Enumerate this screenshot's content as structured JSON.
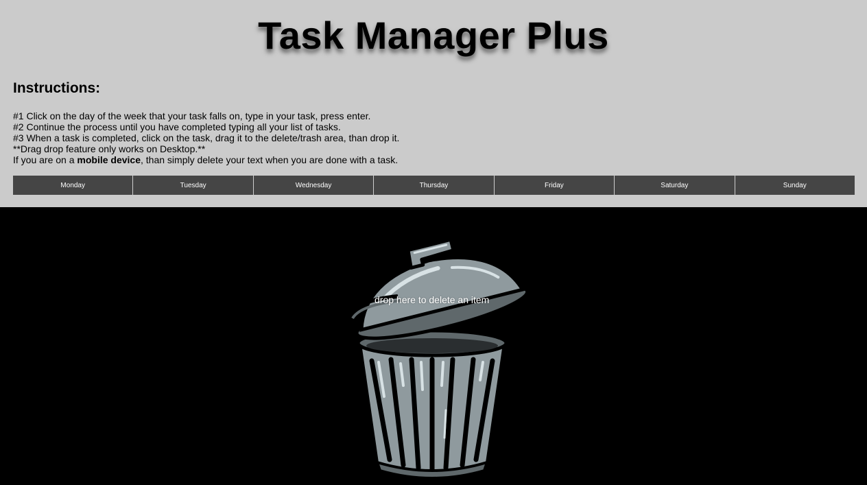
{
  "header": {
    "title": "Task Manager Plus"
  },
  "instructions": {
    "heading": "Instructions:",
    "line1": "#1 Click on the day of the week that your task falls on, type in your task, press enter.",
    "line2": "#2 Continue the process until you have completed typing all your list of tasks.",
    "line3": "#3 When a task is completed, click on the task, drag it to the delete/trash area, than drop it.",
    "line4": "**Drag drop feature only works on Desktop.**",
    "line5_prefix": "If you are on a ",
    "line5_bold": "mobile device",
    "line5_suffix": ", than simply delete your text when you are done with a task."
  },
  "days": [
    "Monday",
    "Tuesday",
    "Wednesday",
    "Thursday",
    "Friday",
    "Saturday",
    "Sunday"
  ],
  "trash": {
    "label": "drop here to delete an item",
    "icon": "trash-can-icon"
  },
  "colors": {
    "top_background": "#cbcbcb",
    "day_tab_background": "#454545",
    "trash_background": "#000000",
    "trash_can_metal": "#8f9a9e"
  }
}
